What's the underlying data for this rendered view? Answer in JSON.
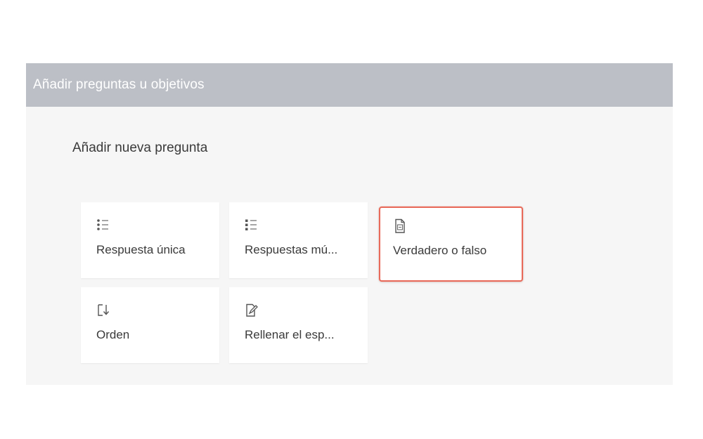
{
  "dialog": {
    "title": "Añadir preguntas u objetivos",
    "section_title": "Añadir nueva pregunta"
  },
  "cards": [
    {
      "label": "Respuesta única",
      "icon": "single-choice-list-icon"
    },
    {
      "label": "Respuestas mú...",
      "icon": "multiple-choice-list-icon"
    },
    {
      "label": "Verdadero o falso",
      "icon": "true-false-document-icon",
      "selected": true
    },
    {
      "label": "Orden",
      "icon": "order-icon"
    },
    {
      "label": "Rellenar el esp...",
      "icon": "fill-blank-icon"
    }
  ],
  "colors": {
    "header_bg": "#bcbfc6",
    "panel_bg": "#f6f6f6",
    "highlight_border": "#e86a5a"
  }
}
